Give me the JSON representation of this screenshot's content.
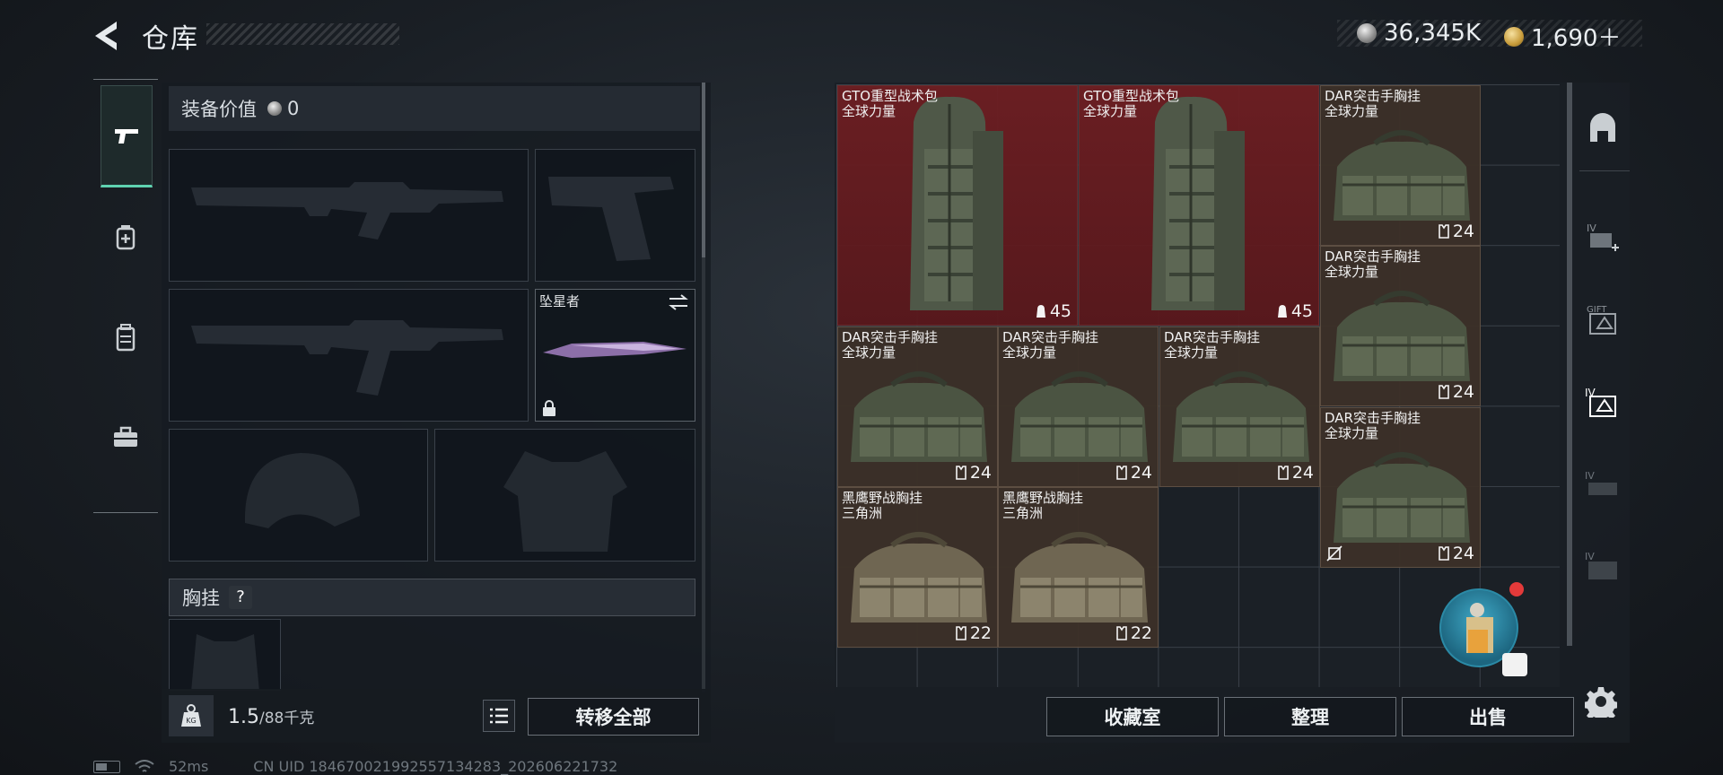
{
  "header": {
    "title": "仓库"
  },
  "currency": {
    "silver": "36,345K",
    "gold": "1,690＋"
  },
  "sidebar": {
    "tabs": [
      {
        "name": "weapons",
        "icon": "pistol-icon",
        "active": true
      },
      {
        "name": "medkit",
        "icon": "medkit-icon"
      },
      {
        "name": "backpack",
        "icon": "backpack-icon"
      },
      {
        "name": "toolbox",
        "icon": "toolbox-icon"
      }
    ]
  },
  "loadout": {
    "value_label": "装备价值",
    "value": "0",
    "melee_label": "坠星者",
    "vest_section": "胸挂",
    "help_mark": "?",
    "weight_current": "1.5",
    "weight_max": "/88千克",
    "transfer_all": "转移全部"
  },
  "stash": {
    "items": [
      {
        "name_line1": "GTO重型战术包",
        "name_line2": "全球力量",
        "count": "45",
        "color": "red"
      },
      {
        "name_line1": "GTO重型战术包",
        "name_line2": "全球力量",
        "count": "45",
        "color": "red"
      },
      {
        "name_line1": "DAR突击手胸挂",
        "name_line2": "全球力量",
        "count": "24",
        "color": "brown"
      },
      {
        "name_line1": "DAR突击手胸挂",
        "name_line2": "全球力量",
        "count": "24",
        "color": "brown"
      },
      {
        "name_line1": "DAR突击手胸挂",
        "name_line2": "全球力量",
        "count": "24",
        "color": "brown"
      },
      {
        "name_line1": "DAR突击手胸挂",
        "name_line2": "全球力量",
        "count": "24",
        "color": "brown"
      },
      {
        "name_line1": "DAR突击手胸挂",
        "name_line2": "全球力量",
        "count": "24",
        "color": "brown"
      },
      {
        "name_line1": "DAR突击手胸挂",
        "name_line2": "全球力量",
        "count": "24",
        "color": "brown"
      },
      {
        "name_line1": "黑鹰野战胸挂",
        "name_line2": "三角洲",
        "count": "22",
        "color": "brown"
      },
      {
        "name_line1": "黑鹰野战胸挂",
        "name_line2": "三角洲",
        "count": "22",
        "color": "brown"
      }
    ],
    "buttons": {
      "collection": "收藏室",
      "sort": "整理",
      "sell": "出售"
    }
  },
  "status": {
    "ping": "52ms",
    "uid": "CN UID 18467002199255713428​3_202606221732"
  }
}
